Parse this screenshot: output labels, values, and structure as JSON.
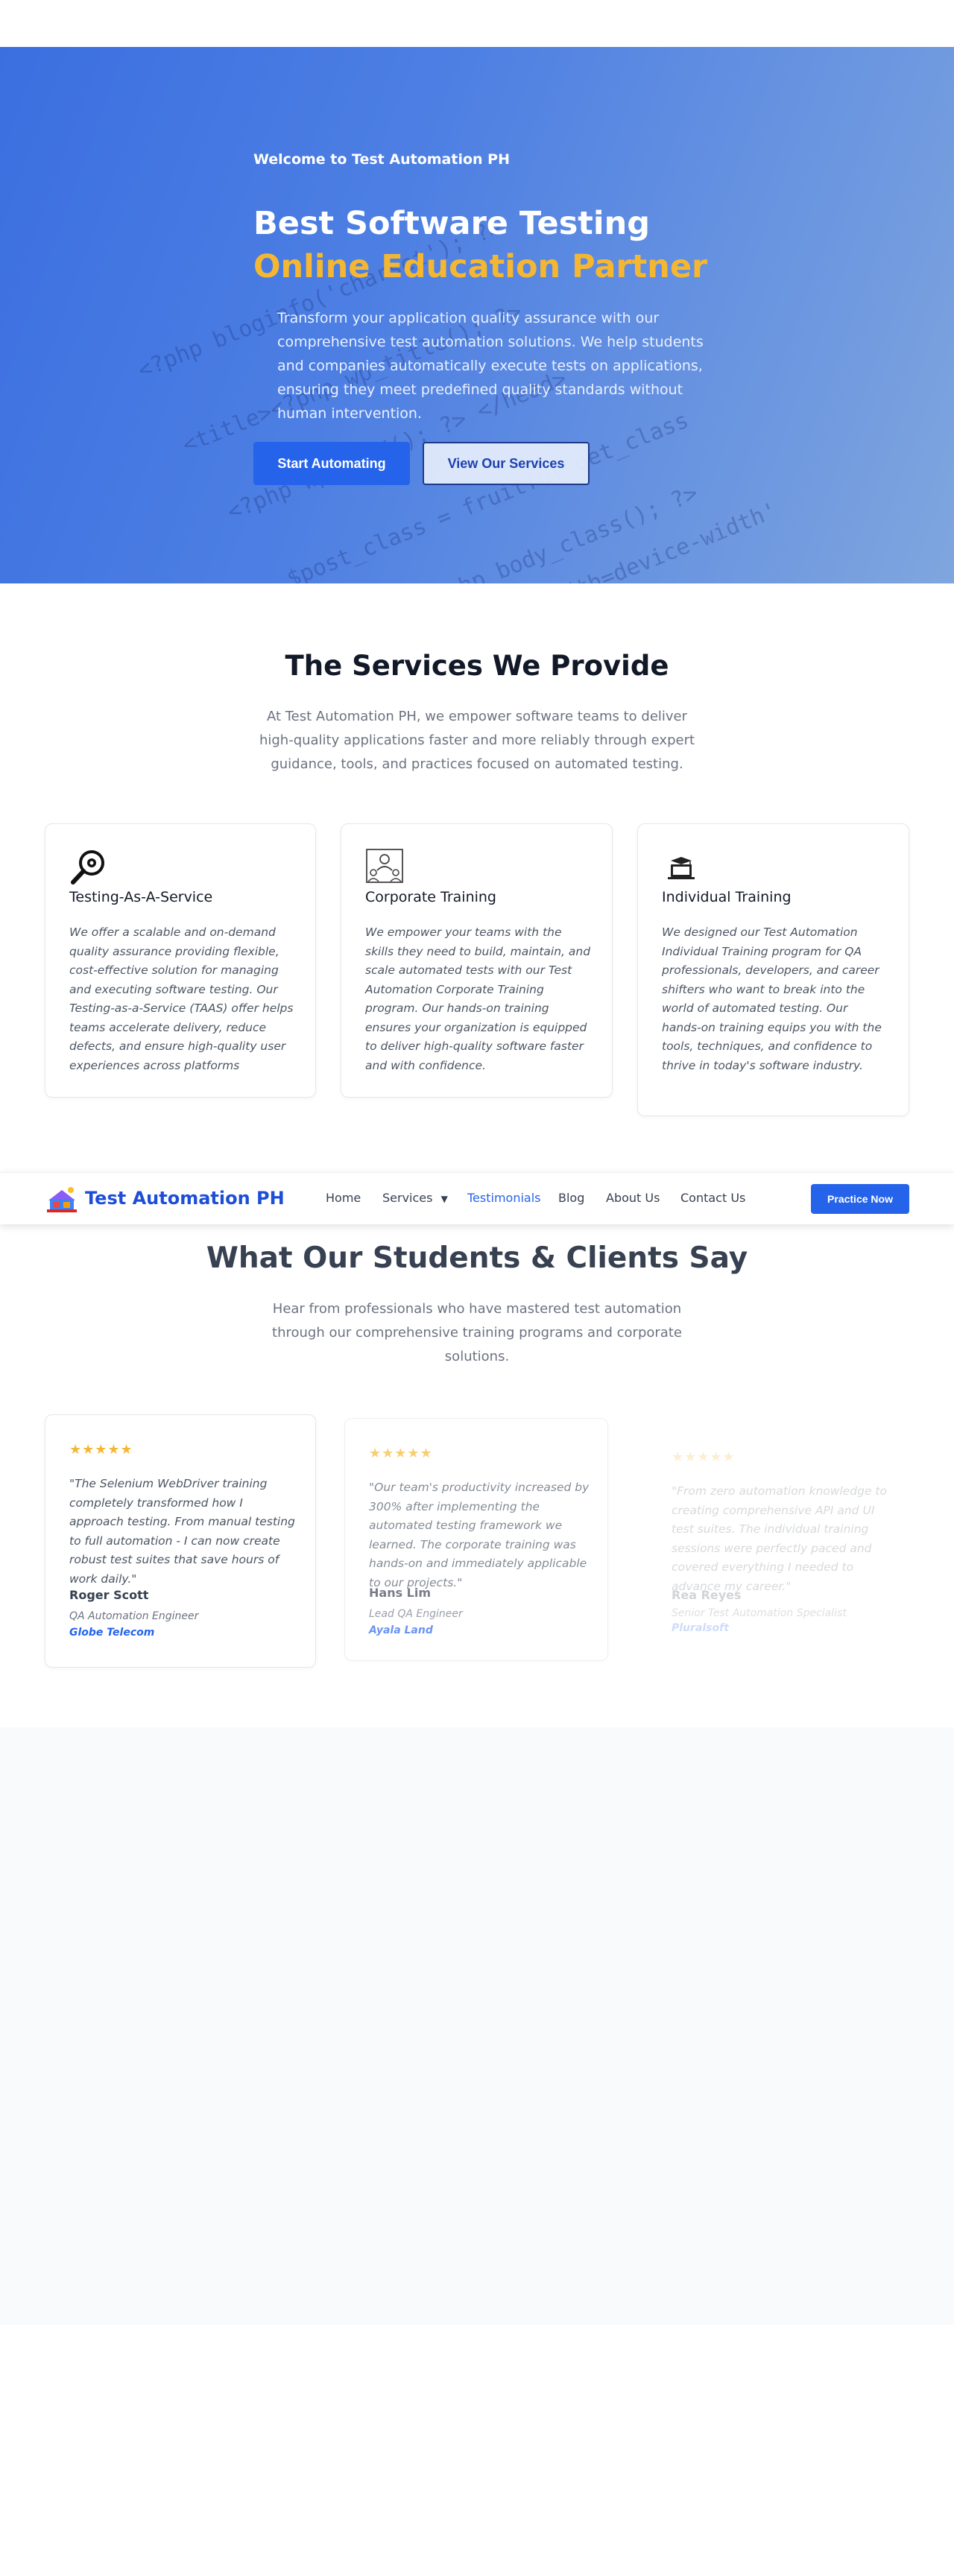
{
  "hero": {
    "welcome": "Welcome to Test Automation PH",
    "title_line1": "Best Software Testing",
    "title_line2": "Online Education Partner",
    "description": "Transform your application quality assurance with our comprehensive test automation solutions. We help students and companies automatically execute tests on applications, ensuring they meet predefined quality standards without human intervention.",
    "primary_button": "Start Automating",
    "secondary_button": "View Our Services"
  },
  "services": {
    "title": "The Services We Provide",
    "subtitle": "At Test Automation PH, we empower software teams to deliver high-quality applications faster and more reliably through expert guidance, tools, and practices focused on automated testing.",
    "cards": [
      {
        "icon": "magnifier-gear-icon",
        "title": "Testing-As-A-Service",
        "text": "We offer a scalable and on-demand quality assurance providing flexible, cost-effective solution for managing and executing software testing. Our Testing-as-a-Service (TAAS) offer helps teams accelerate delivery, reduce defects, and ensure high-quality user experiences across platforms"
      },
      {
        "icon": "team-presentation-icon",
        "title": "Corporate Training",
        "text": "We empower your teams with the skills they need to build, maintain, and scale automated tests with our Test Automation Corporate Training program. Our hands-on training ensures your organization is equipped to deliver high-quality software faster and with confidence."
      },
      {
        "icon": "laptop-graduation-icon",
        "title": "Individual Training",
        "text": "We designed our Test Automation Individual Training program for QA professionals, developers, and career shifters who want to break into the world of automated testing. Our hands-on training equips you with the tools, techniques, and confidence to thrive in today's software industry."
      }
    ]
  },
  "nav": {
    "logo_text": "Test Automation PH",
    "items": [
      "Home",
      "Services",
      "Testimonials",
      "Blog",
      "About Us",
      "Contact Us"
    ],
    "dropdown_glyph": "▼",
    "cta": "Practice Now"
  },
  "testimonials": {
    "title": "What Our Students & Clients Say",
    "subtitle": "Hear from professionals who have mastered test automation through our comprehensive training programs and corporate solutions.",
    "stars": "★★★★★",
    "items": [
      {
        "quote": "\"The Selenium WebDriver training completely transformed how I approach testing. From manual testing to full automation - I can now create robust test suites that save hours of work daily.\"",
        "name": "Roger Scott",
        "role": "QA Automation Engineer",
        "company": "Globe Telecom"
      },
      {
        "quote": "\"Our team's productivity increased by 300% after implementing the automated testing framework we learned. The corporate training was hands-on and immediately applicable to our projects.\"",
        "name": "Hans Lim",
        "role": "Lead QA Engineer",
        "company": "Ayala Land"
      },
      {
        "quote": "\"From zero automation knowledge to creating comprehensive API and UI test suites. The individual training sessions were perfectly paced and covered everything I needed to advance my career.\"",
        "name": "Rea Reyes",
        "role": "Senior Test Automation Specialist",
        "company": "Pluralsoft"
      }
    ]
  },
  "colors": {
    "brand": "#2563eb",
    "accent": "#f5b731"
  }
}
